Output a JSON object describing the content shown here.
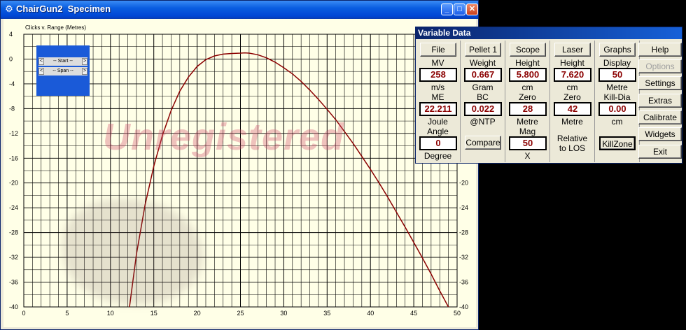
{
  "window": {
    "title": "ChairGun2  Specimen",
    "minimize": "_",
    "maximize": "□",
    "close": "✕"
  },
  "watermark": "Unregistered",
  "scroll_widget": {
    "start": "-- Start --",
    "span": "-- Span --",
    "left_arrow": "<",
    "right_arrow": ">"
  },
  "chart_data": {
    "type": "line",
    "title": "Clicks v. Range (Metres)",
    "xlim": [
      0,
      50
    ],
    "ylim": [
      -40,
      4
    ],
    "x_ticks": [
      0,
      5,
      10,
      15,
      20,
      25,
      30,
      35,
      40,
      45,
      50
    ],
    "y_ticks": [
      4,
      0,
      -4,
      -8,
      -12,
      -16,
      -20,
      -24,
      -28,
      -32,
      -36,
      -40
    ],
    "grid": true,
    "series": [
      {
        "color": "#8b0000",
        "x": [
          12.2,
          13,
          14,
          15,
          16,
          17,
          18,
          19,
          20,
          21,
          22,
          23,
          24,
          25,
          25.5,
          26,
          27,
          28,
          29,
          30,
          31,
          32,
          33,
          34,
          35,
          36,
          37,
          38,
          39,
          40,
          41,
          42,
          43,
          44,
          45,
          46,
          47,
          48,
          49,
          50
        ],
        "y": [
          -40,
          -31.5,
          -23.5,
          -17.3,
          -12.3,
          -8.3,
          -5.2,
          -2.9,
          -1.2,
          -0.1,
          0.5,
          0.8,
          0.9,
          0.95,
          1.0,
          0.95,
          0.7,
          0.2,
          -0.5,
          -1.4,
          -2.4,
          -3.6,
          -5.0,
          -6.5,
          -8.1,
          -9.8,
          -11.7,
          -13.6,
          -15.7,
          -17.8,
          -20.0,
          -22.3,
          -24.7,
          -27.1,
          -29.6,
          -32.1,
          -34.7,
          -37.4,
          -40.0,
          -42.5
        ]
      }
    ]
  },
  "variable_data": {
    "title": "Variable Data",
    "col1": {
      "button": "File",
      "label1": "MV",
      "value1": "258",
      "unit1": "m/s",
      "label2": "ME",
      "value2": "22.211",
      "unit2": "Joule",
      "label3": "Angle",
      "value3": "0",
      "unit3": "Degree"
    },
    "col2": {
      "button": "Pellet 1",
      "label1": "Weight",
      "value1": "0.667",
      "unit1": "Gram",
      "label2": "BC",
      "value2": "0.022",
      "unit2": "@NTP",
      "compare": "Compare"
    },
    "col3": {
      "button": "Scope",
      "label1": "Height",
      "value1": "5.800",
      "unit1": "cm",
      "label2": "Zero",
      "value2": "28",
      "unit2": "Metre",
      "label3": "Mag",
      "value3": "50",
      "unit3": "X"
    },
    "col4": {
      "button": "Laser",
      "label1": "Height",
      "value1": "7.620",
      "unit1": "cm",
      "label2": "Zero",
      "value2": "42",
      "unit2": "Metre",
      "note1": "Relative",
      "note2": "to LOS"
    },
    "col5": {
      "button": "Graphs",
      "label1": "Display",
      "value1": "50",
      "unit1": "Metre",
      "label2": "Kill-Dia",
      "value2": "0.00",
      "unit2": "cm",
      "killzone": "KillZone"
    },
    "right_buttons": {
      "help": "Help",
      "options": "Options",
      "settings": "Settings",
      "extras": "Extras",
      "calibrate": "Calibrate",
      "widgets": "Widgets",
      "exit": "Exit"
    }
  }
}
